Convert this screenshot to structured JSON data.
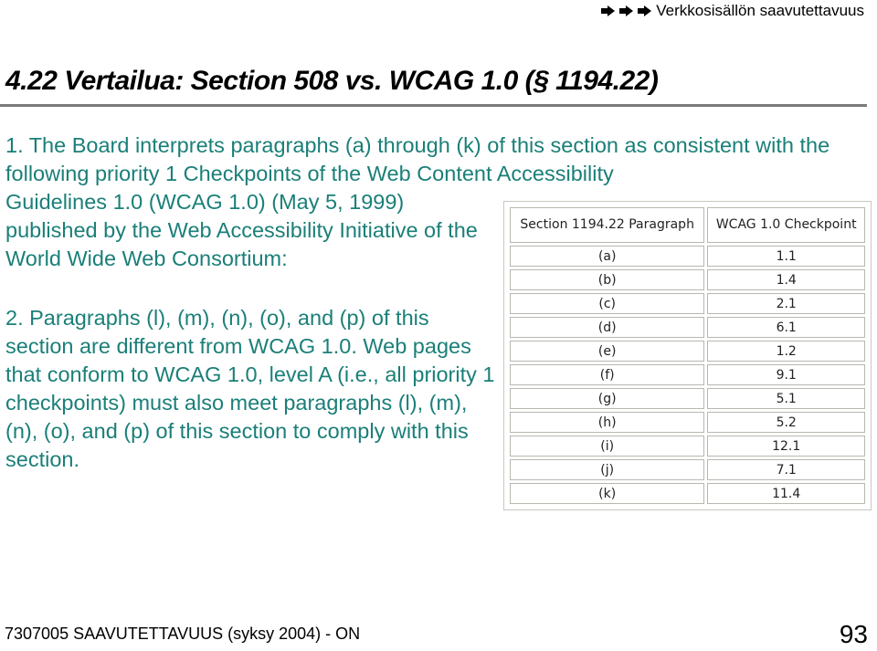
{
  "header": {
    "nav_icons": [
      "arrow-right-icon",
      "arrow-right-icon",
      "arrow-right-icon"
    ],
    "nav_title": "Verkkosisällön saavutettavuus"
  },
  "slide": {
    "title": "4.22 Vertailua: Section 508 vs. WCAG 1.0 (§ 1194.22)",
    "paragraph1_lines_full": "1. The Board interprets paragraphs (a) through (k) of this section as consistent with the following priority 1 Checkpoints of the Web Content Accessibility",
    "paragraph1_rest": "Guidelines 1.0 (WCAG 1.0) (May 5, 1999) published by the Web Accessibility Initiative of the World Wide Web Consortium:",
    "paragraph2": "2. Paragraphs (l), (m), (n), (o), and (p) of this section are different from WCAG 1.0. Web pages that conform to WCAG 1.0, level A (i.e., all priority 1 checkpoints) must also meet paragraphs (l), (m), (n), (o), and (p) of this section to comply with this section."
  },
  "table": {
    "headers": [
      "Section 1194.22 Paragraph",
      "WCAG 1.0 Checkpoint"
    ],
    "rows": [
      [
        "(a)",
        "1.1"
      ],
      [
        "(b)",
        "1.4"
      ],
      [
        "(c)",
        "2.1"
      ],
      [
        "(d)",
        "6.1"
      ],
      [
        "(e)",
        "1.2"
      ],
      [
        "(f)",
        "9.1"
      ],
      [
        "(g)",
        "5.1"
      ],
      [
        "(h)",
        "5.2"
      ],
      [
        "(i)",
        "12.1"
      ],
      [
        "(j)",
        "7.1"
      ],
      [
        "(k)",
        "11.4"
      ]
    ]
  },
  "footer": {
    "course": "7307005 SAAVUTETTAVUUS (syksy 2004) - ON",
    "page_number": "93"
  }
}
